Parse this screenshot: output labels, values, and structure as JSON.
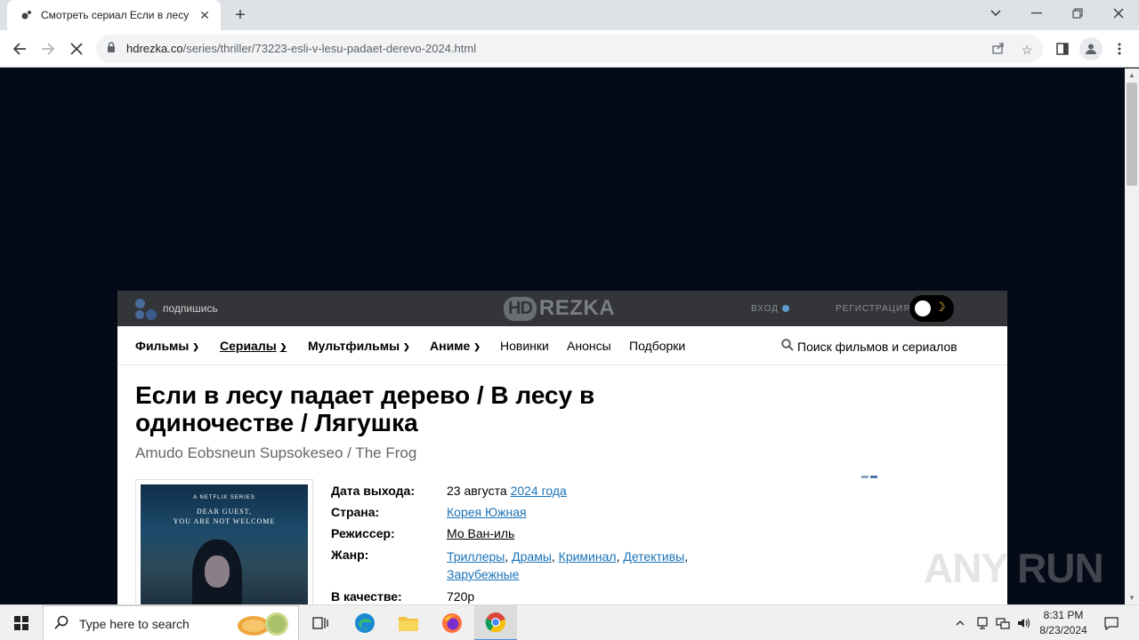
{
  "browser": {
    "tab_title": "Смотреть сериал Если в лесу п",
    "url_host": "hdrezka.co",
    "url_path": "/series/thriller/73223-esli-v-lesu-padaet-derevo-2024.html"
  },
  "site": {
    "subscribe_label": "подпишись",
    "logo_hd": "HD",
    "logo_rezka": "REZKA",
    "login_label": "ВХОД",
    "register_label": "РЕГИСТРАЦИЯ",
    "nav": [
      {
        "label": "Фильмы"
      },
      {
        "label": "Сериалы"
      },
      {
        "label": "Мультфильмы"
      },
      {
        "label": "Аниме"
      },
      {
        "label": "Новинки"
      },
      {
        "label": "Анонсы"
      },
      {
        "label": "Подборки"
      }
    ],
    "search_label": "Поиск фильмов и сериалов"
  },
  "movie": {
    "title": "Если в лесу падает дерево / В лесу в одиночестве / Лягушка",
    "original_title": "Amudo Eobsneun Supsokeseo / The Frog",
    "poster_badge": "A NETFLIX SERIES",
    "poster_tagline_1": "DEAR GUEST,",
    "poster_tagline_2": "YOU ARE NOT WELCOME",
    "release_label": "Дата выхода:",
    "release_date": "23 августа",
    "release_year": "2024 года",
    "country_label": "Страна:",
    "country": "Корея Южная",
    "director_label": "Режиссер:",
    "director": "Мо Ван-иль",
    "genre_label": "Жанр:",
    "genres": [
      "Триллеры",
      "Драмы",
      "Криминал",
      "Детективы",
      "Зарубежные"
    ],
    "quality_label": "В качестве:",
    "quality": "720p"
  },
  "watermark": "ANY RUN",
  "taskbar": {
    "search_placeholder": "Type here to search",
    "time": "8:31 PM",
    "date": "8/23/2024"
  },
  "colors": {
    "page_bg": "#050a18",
    "header_bg": "#333538",
    "link": "#1a73b8"
  }
}
